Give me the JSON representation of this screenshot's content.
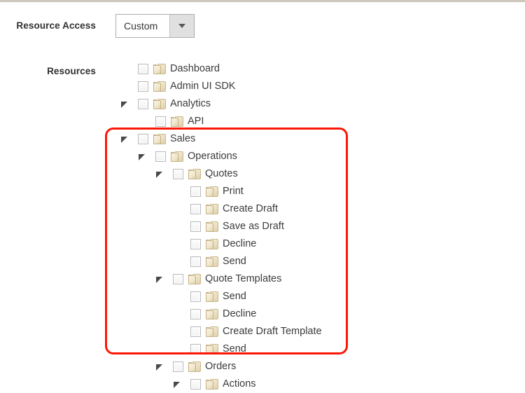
{
  "form": {
    "resource_access_label": "Resource Access",
    "resources_label": "Resources",
    "access_mode": {
      "value": "Custom",
      "icon": "chevron-down-icon"
    }
  },
  "tree": {
    "icon": "folder-stack-icon",
    "checkbox_state": "unchecked",
    "nodes": [
      {
        "label": "Dashboard",
        "depth": 0,
        "expandable": false,
        "expanded": false
      },
      {
        "label": "Admin UI SDK",
        "depth": 0,
        "expandable": false,
        "expanded": false
      },
      {
        "label": "Analytics",
        "depth": 0,
        "expandable": true,
        "expanded": true
      },
      {
        "label": "API",
        "depth": 1,
        "expandable": false,
        "expanded": false
      },
      {
        "label": "Sales",
        "depth": 0,
        "expandable": true,
        "expanded": true
      },
      {
        "label": "Operations",
        "depth": 1,
        "expandable": true,
        "expanded": true
      },
      {
        "label": "Quotes",
        "depth": 2,
        "expandable": true,
        "expanded": true
      },
      {
        "label": "Print",
        "depth": 3,
        "expandable": false,
        "expanded": false
      },
      {
        "label": "Create Draft",
        "depth": 3,
        "expandable": false,
        "expanded": false
      },
      {
        "label": "Save as Draft",
        "depth": 3,
        "expandable": false,
        "expanded": false
      },
      {
        "label": "Decline",
        "depth": 3,
        "expandable": false,
        "expanded": false
      },
      {
        "label": "Send",
        "depth": 3,
        "expandable": false,
        "expanded": false
      },
      {
        "label": "Quote Templates",
        "depth": 2,
        "expandable": true,
        "expanded": true
      },
      {
        "label": "Send",
        "depth": 3,
        "expandable": false,
        "expanded": false
      },
      {
        "label": "Decline",
        "depth": 3,
        "expandable": false,
        "expanded": false
      },
      {
        "label": "Create Draft Template",
        "depth": 3,
        "expandable": false,
        "expanded": false
      },
      {
        "label": "Send",
        "depth": 3,
        "expandable": false,
        "expanded": false
      },
      {
        "label": "Orders",
        "depth": 2,
        "expandable": true,
        "expanded": true
      },
      {
        "label": "Actions",
        "depth": 3,
        "expandable": true,
        "expanded": true
      }
    ]
  },
  "annotation": {
    "highlight_color": "#fb1707",
    "shape": "rounded-rectangle"
  },
  "colors": {
    "top_rule": "#cec8bc",
    "label_text": "#303030",
    "node_text": "#3b3b3b",
    "dropdown_border": "#adadad",
    "dropdown_arrow_bg": "#e0e0e0"
  }
}
